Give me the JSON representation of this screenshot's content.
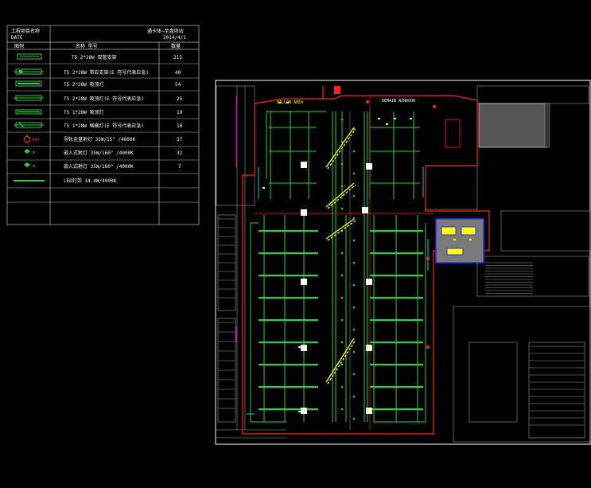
{
  "legend": {
    "project_label_line1": "工程项目名称",
    "project_label_line2": "DATE",
    "project_name": "通卡体—至盘场站",
    "date": "2014/4/1",
    "headers": {
      "legend": "图例",
      "name_model": "名称 型号",
      "quantity": "数量"
    },
    "rows": [
      {
        "symbol": "t5-double-fixture",
        "name": "T5 2*28W 双管支架",
        "quantity": "213",
        "color": "#2ecc40"
      },
      {
        "symbol": "t5-double-emergency",
        "name": "T5 2*28W 带应支架(E 符号代表应急)",
        "quantity": "40",
        "color": "#2ecc40"
      },
      {
        "symbol": "t5-double-ceiling",
        "name": "T5 2*28W 吸顶灯",
        "quantity": "54",
        "color": "#2ecc40"
      },
      {
        "symbol": "t5-double-ceiling-emergency",
        "name": "T5 2*28W 吸顶灯(E 符号代表应急)",
        "quantity": "25",
        "color": "#2ecc40"
      },
      {
        "symbol": "t5-single-ceiling",
        "name": "T5 1*28W 吸顶灯",
        "quantity": "19",
        "color": "#2ecc40"
      },
      {
        "symbol": "t5-single-bracket",
        "name": "T5 1*28W 格栅灯(E 符号代表应急)",
        "quantity": "10",
        "color": "#2ecc40"
      },
      {
        "symbol": "track-spot",
        "name": "导轨金盘射灯 35W/15° /4000K",
        "quantity": "37",
        "color": "#ff3333",
        "tag": "A40"
      },
      {
        "symbol": "recessed-spot-a",
        "name": "嵌入式射灯 35W/160° /4000K",
        "quantity": "32",
        "color": "#2ecc40",
        "tag": "m"
      },
      {
        "symbol": "recessed-spot-b",
        "name": "嵌入式射灯 35W/160° /4000K",
        "quantity": "7",
        "color": "#2ecc40",
        "tag": "m"
      },
      {
        "symbol": "led-strip",
        "name": "LED灯带 14.4W/4000K",
        "quantity": "",
        "color": "#2ecc40"
      }
    ]
  },
  "plan": {
    "label_top": "DEMAIN WINDOOR",
    "label_left": "FALLOW AREA"
  },
  "colors": {
    "line_white": "#ffffff",
    "line_grey": "#9a9a9a",
    "fixture_green": "#2ecc40",
    "wall_red": "#ff2020",
    "accent_yellow": "#ffff00",
    "accent_cyan": "#00ffff",
    "accent_magenta": "#ff00ff",
    "room_blue": "#2a2aff"
  }
}
